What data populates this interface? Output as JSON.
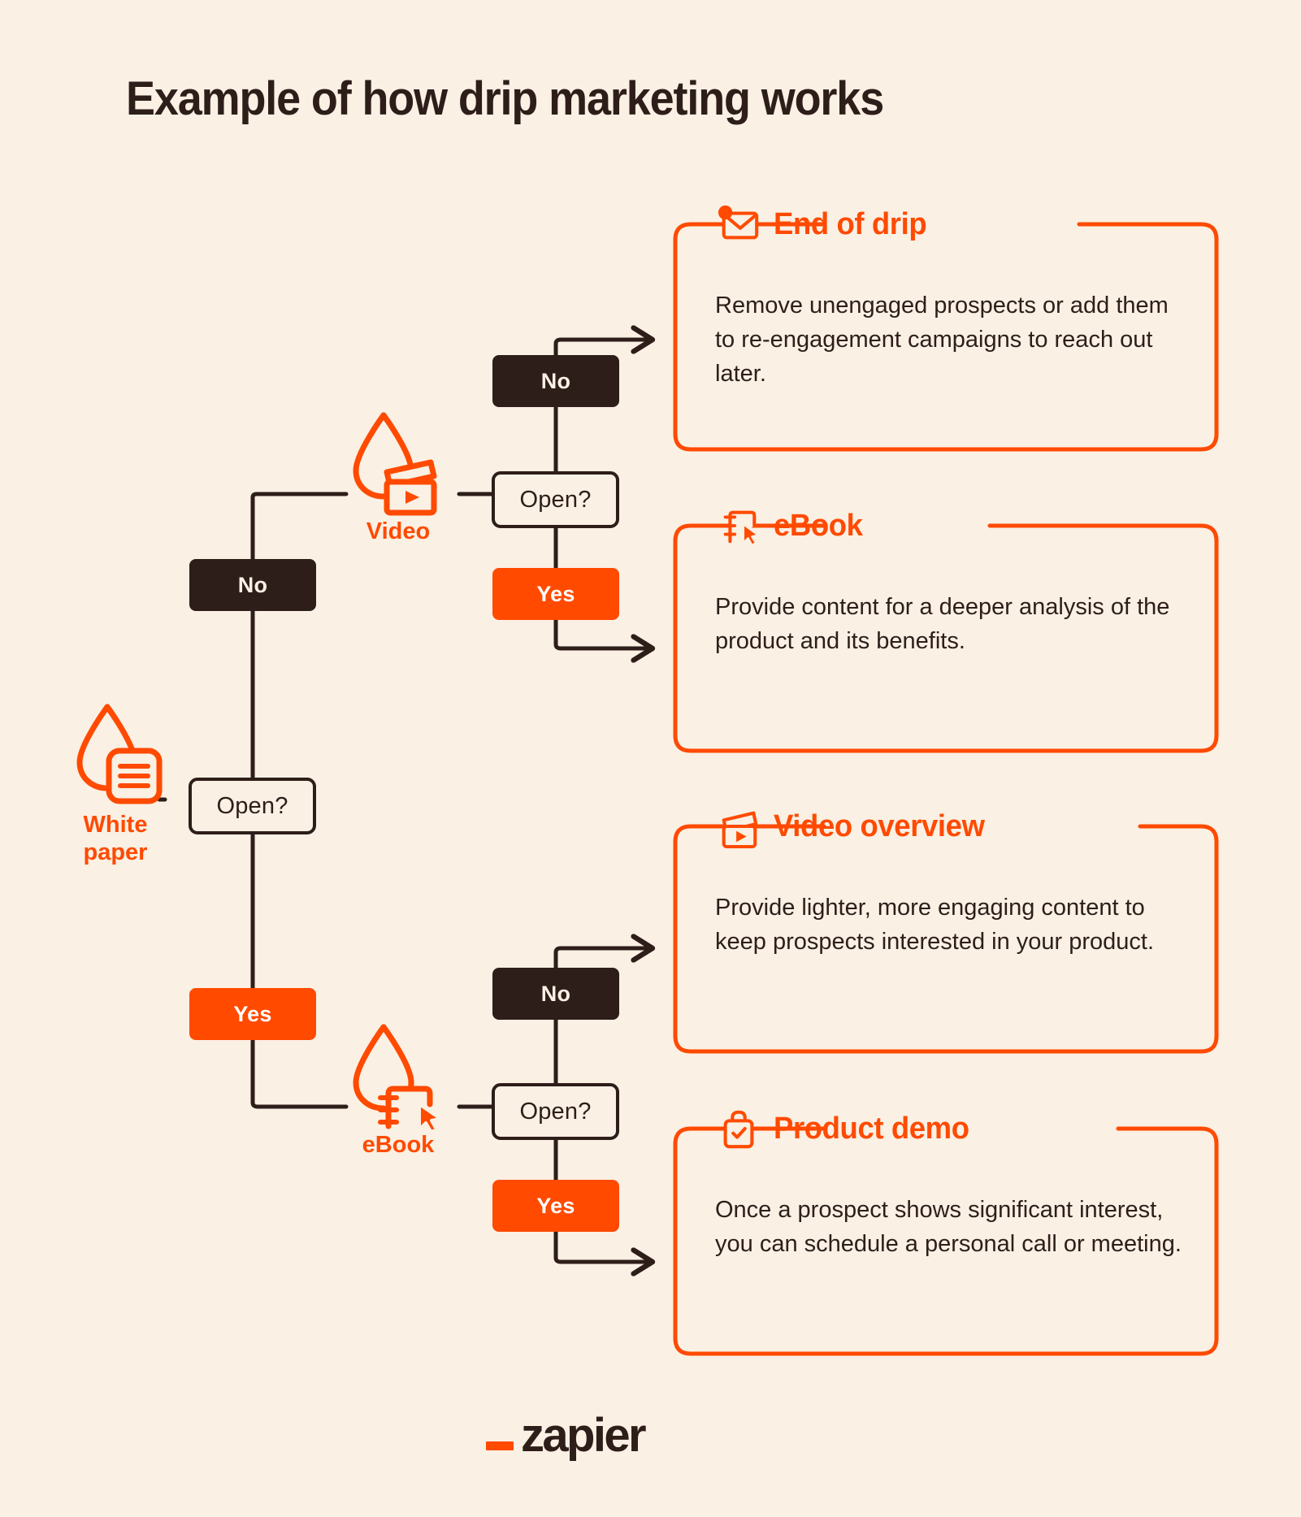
{
  "page": {
    "title": "Example of how drip marketing works",
    "background_color": "#FAF0E4",
    "accent_color": "#FF4A00",
    "dark_color": "#2E1E1A"
  },
  "flow": {
    "start_node": {
      "label": "White\npaper",
      "icon": "drip-whitepaper-icon"
    },
    "decisions": [
      {
        "id": "open1",
        "label": "Open?"
      },
      {
        "id": "open2",
        "label": "Open?"
      },
      {
        "id": "open3",
        "label": "Open?"
      }
    ],
    "branches": [
      {
        "id": "b1",
        "label": "No",
        "type": "no"
      },
      {
        "id": "b2",
        "label": "Yes",
        "type": "yes"
      },
      {
        "id": "b3",
        "label": "No",
        "type": "no"
      },
      {
        "id": "b4",
        "label": "Yes",
        "type": "yes"
      },
      {
        "id": "b5",
        "label": "No",
        "type": "no"
      },
      {
        "id": "b6",
        "label": "Yes",
        "type": "yes"
      }
    ],
    "mid_nodes": [
      {
        "id": "video",
        "label": "Video",
        "icon": "drip-video-icon"
      },
      {
        "id": "ebook",
        "label": "eBook",
        "icon": "drip-ebook-icon"
      }
    ]
  },
  "cards": [
    {
      "id": "end-of-drip",
      "icon": "envelope-alert-icon",
      "title": "End of drip",
      "body": "Remove unengaged prospects or add them to re-engagement campaigns to reach out later."
    },
    {
      "id": "ebook",
      "icon": "notebook-cursor-icon",
      "title": "eBook",
      "body": "Provide content for a deeper analysis of the product and its benefits."
    },
    {
      "id": "video-overview",
      "icon": "clapperboard-icon",
      "title": "Video overview",
      "body": "Provide lighter, more engaging content to keep prospects interested in your product."
    },
    {
      "id": "product-demo",
      "icon": "bag-check-icon",
      "title": "Product demo",
      "body": "Once a prospect shows significant interest, you can schedule a personal call or meeting."
    }
  ],
  "footer": {
    "brand": "zapier"
  }
}
